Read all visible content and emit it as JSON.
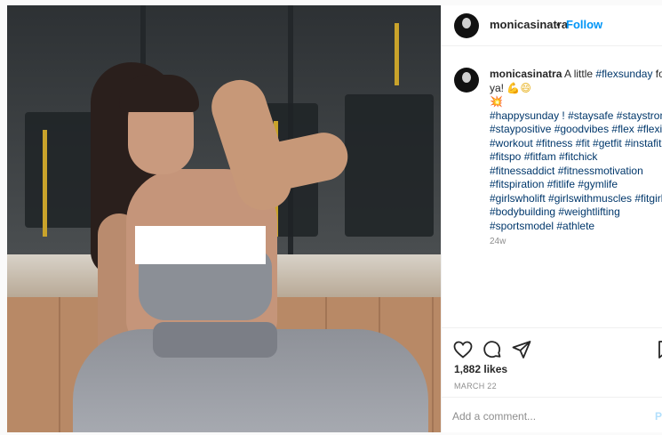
{
  "post": {
    "username": "monicasinatra",
    "follow_label": "Follow",
    "dot": "•",
    "caption": {
      "intro": "A little",
      "intro_tag": "#flexsunday",
      "intro_tail": "for",
      "line2_prefix": "ya!",
      "emoji_muscle": "💪",
      "emoji_smile": "😄",
      "emoji_spark": "💥",
      "line_happysunday": "#happysunday ! #staysafe #staystrong",
      "line_positive": "#staypositive #goodvibes #flex #flexin",
      "line_workout": "#workout #fitness #fit #getfit #instafit",
      "line_fitspo": "#fitspo #fitfam #fitchick",
      "line_addict": "#fitnessaddict #fitnessmotivation",
      "line_fitspiration": "#fitspiration #fitlife #gymlife",
      "line_girls": "#girlswholift #girlswithmuscles #fitgirl",
      "line_body": "#bodybuilding #weightlifting",
      "line_sports": "#sportsmodel #athlete"
    },
    "time_ago": "24w",
    "likes": "1,882 likes",
    "date": "MARCH 22",
    "comment_placeholder": "Add a comment...",
    "post_label": "Post"
  },
  "icons": {
    "like": "heart-icon",
    "comment": "comment-icon",
    "share": "share-icon",
    "save": "bookmark-icon"
  }
}
